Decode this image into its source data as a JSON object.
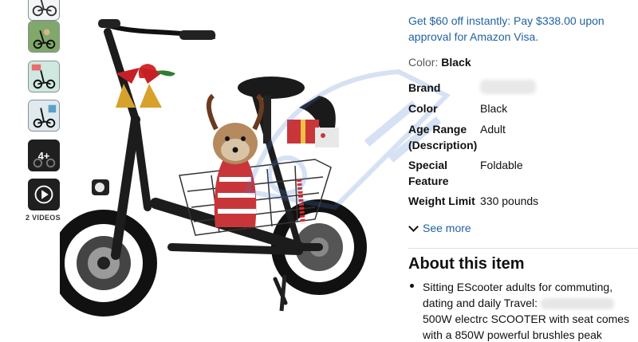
{
  "gallery": {
    "thumbnails": [
      {
        "name": "thumb-1"
      },
      {
        "name": "thumb-2"
      },
      {
        "name": "thumb-3"
      },
      {
        "name": "thumb-4"
      },
      {
        "name": "thumb-more",
        "count_label": "4+"
      },
      {
        "name": "thumb-video"
      }
    ],
    "videos_label": "2 VIDEOS",
    "video_icon": "play-icon"
  },
  "offer": {
    "text": "Get $60 off instantly: Pay $338.00 upon approval for Amazon Visa."
  },
  "color_selection": {
    "label": "Color:",
    "value": "Black"
  },
  "specs": [
    {
      "label": "Brand",
      "value": ""
    },
    {
      "label": "Color",
      "value": "Black"
    },
    {
      "label": "Age Range",
      "label2": "(Description)",
      "value": "Adult"
    },
    {
      "label": "Special",
      "label2": "Feature",
      "value": "Foldable"
    },
    {
      "label": "Weight Limit",
      "value": "330 pounds"
    }
  ],
  "see_more": {
    "label": "See more",
    "icon": "chevron-down-icon"
  },
  "about": {
    "title": "About this item",
    "bullet_lines": [
      "Sitting EScooter adults for commuting,",
      "dating and daily Travel:",
      "500W electrc SCOOTER with seat comes",
      "with a 850W powerful brushles peak"
    ]
  },
  "colors": {
    "link": "#2162a1",
    "text": "#0f1111",
    "muted": "#565959",
    "watermark": "#4a7bd0"
  }
}
